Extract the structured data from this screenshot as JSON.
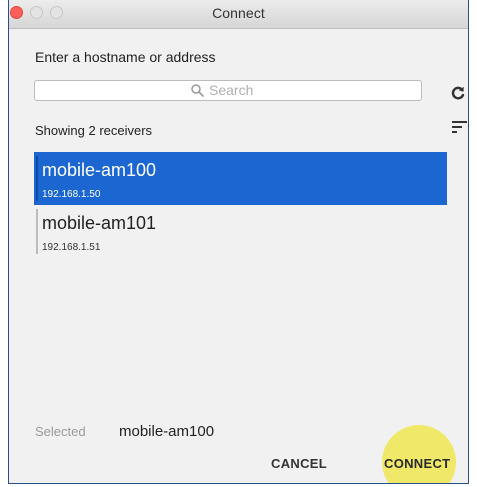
{
  "window": {
    "title": "Connect",
    "accent_color": "#1b66d1"
  },
  "form": {
    "prompt": "Enter a hostname or address",
    "search_placeholder": "Search"
  },
  "receivers": {
    "summary": "Showing 2 receivers",
    "items": [
      {
        "name": "mobile-am100",
        "address": "192.168.1.50",
        "selected": true
      },
      {
        "name": "mobile-am101",
        "address": "192.168.1.51",
        "selected": false
      }
    ]
  },
  "footer": {
    "selected_label": "Selected",
    "selected_value": "mobile-am100",
    "cancel_label": "CANCEL",
    "connect_label": "CONNECT"
  },
  "icons": {
    "refresh": "refresh-icon",
    "sort": "sort-icon",
    "search": "search-icon"
  }
}
